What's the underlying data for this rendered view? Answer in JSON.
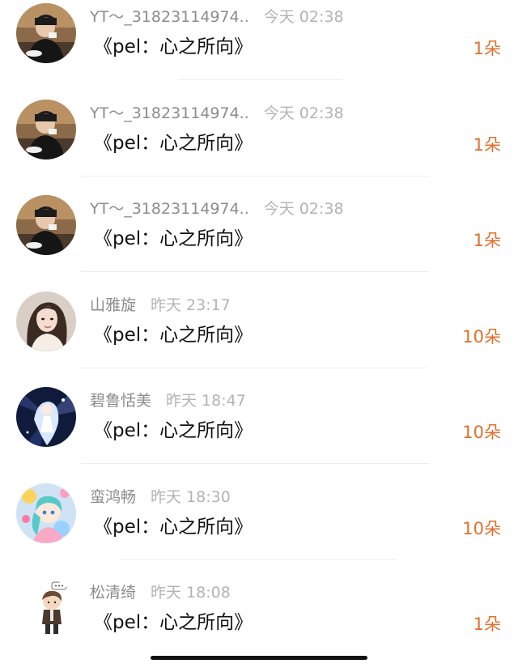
{
  "rows": [
    {
      "name": "YT～_31823114974..",
      "time": "今天 02:38",
      "message": "《pel：心之所向》",
      "count": "1朵",
      "avatar_icon": "avatar-man-photo-icon"
    },
    {
      "name": "YT～_31823114974..",
      "time": "今天 02:38",
      "message": "《pel：心之所向》",
      "count": "1朵",
      "avatar_icon": "avatar-man-photo-icon"
    },
    {
      "name": "YT～_31823114974..",
      "time": "今天 02:38",
      "message": "《pel：心之所向》",
      "count": "1朵",
      "avatar_icon": "avatar-man-photo-icon"
    },
    {
      "name": "山雅旋",
      "time": "昨天 23:17",
      "message": "《pel：心之所向》",
      "count": "10朵",
      "avatar_icon": "avatar-woman-photo-icon"
    },
    {
      "name": "碧鲁恬美",
      "time": "昨天 18:47",
      "message": "《pel：心之所向》",
      "count": "10朵",
      "avatar_icon": "avatar-anime-girl-icon"
    },
    {
      "name": "蛮鸿畅",
      "time": "昨天 18:30",
      "message": "《pel：心之所向》",
      "count": "10朵",
      "avatar_icon": "avatar-cartoon-characters-icon"
    },
    {
      "name": "松清绮",
      "time": "昨天 18:08",
      "message": "《pel：心之所向》",
      "count": "1朵",
      "avatar_icon": "avatar-cartoon-boy-icon"
    }
  ],
  "colors": {
    "count": "#e0702c",
    "name": "#8c8c8c",
    "time": "#b3b3b3",
    "message": "#111111"
  }
}
